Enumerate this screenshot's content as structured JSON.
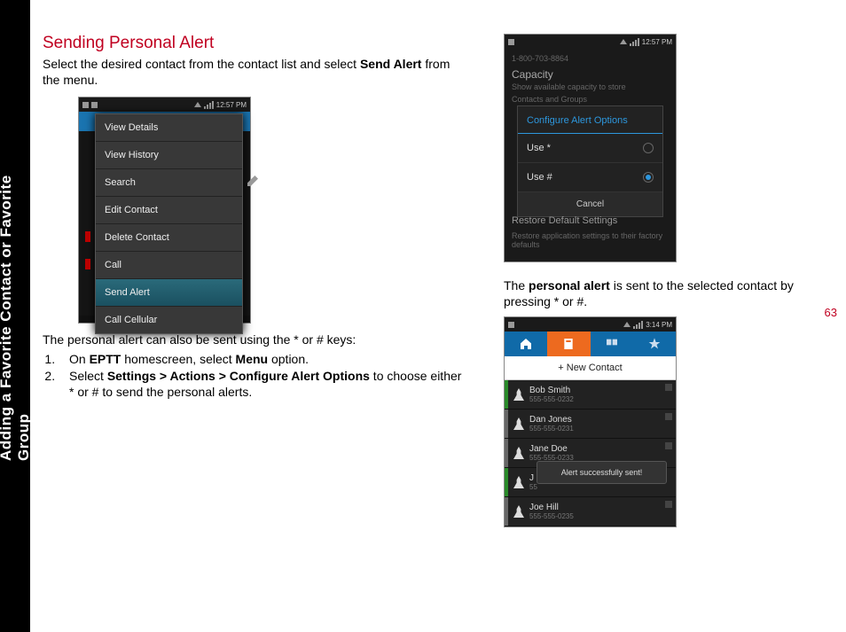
{
  "sidebar_label": "Adding a Favorite Contact or Favorite Group",
  "page_number": "63",
  "heading": "Sending Personal Alert",
  "intro_a": "Select the desired contact from the contact list and select ",
  "intro_b": "Send Alert",
  "intro_c": " from the menu.",
  "after_menu": "The personal alert can also be sent using the * or # keys:",
  "step1_a": "On ",
  "step1_b": "EPTT",
  "step1_c": " homescreen, select ",
  "step1_d": "Menu",
  "step1_e": " option.",
  "step2_a": "Select ",
  "step2_b": "Settings > Actions > Configure Alert Options",
  "step2_c": " to choose either * or # to send the personal alerts.",
  "right_p_a": "The ",
  "right_p_b": "personal alert",
  "right_p_c": " is sent to the selected contact by pressing * or #.",
  "screenshot1": {
    "time": "12:57 PM",
    "menu": [
      "View Details",
      "View History",
      "Search",
      "Edit Contact",
      "Delete Contact",
      "Call",
      "Send Alert",
      "Call Cellular"
    ]
  },
  "screenshot2": {
    "time": "12:57 PM",
    "phone_number": "1-800-703-8864",
    "title": "Capacity",
    "subtitle1": "Show available capacity to store",
    "subtitle2": "Contacts and Groups",
    "dialog_title": "Configure Alert Options",
    "opt1": "Use *",
    "opt2": "Use #",
    "cancel": "Cancel",
    "restore": "Restore Default Settings",
    "restore_sub": "Restore application settings to their factory defaults"
  },
  "screenshot3": {
    "time": "3:14 PM",
    "new_contact": "+ New Contact",
    "toast": "Alert successfully sent!",
    "contacts": [
      {
        "name": "Bob Smith",
        "num": "555-555-0232"
      },
      {
        "name": "Dan Jones",
        "num": "555-555-0231"
      },
      {
        "name": "Jane Doe",
        "num": "555-555-0233"
      },
      {
        "name": "J",
        "num": "55"
      },
      {
        "name": "Joe Hill",
        "num": "555-555-0235"
      }
    ]
  }
}
